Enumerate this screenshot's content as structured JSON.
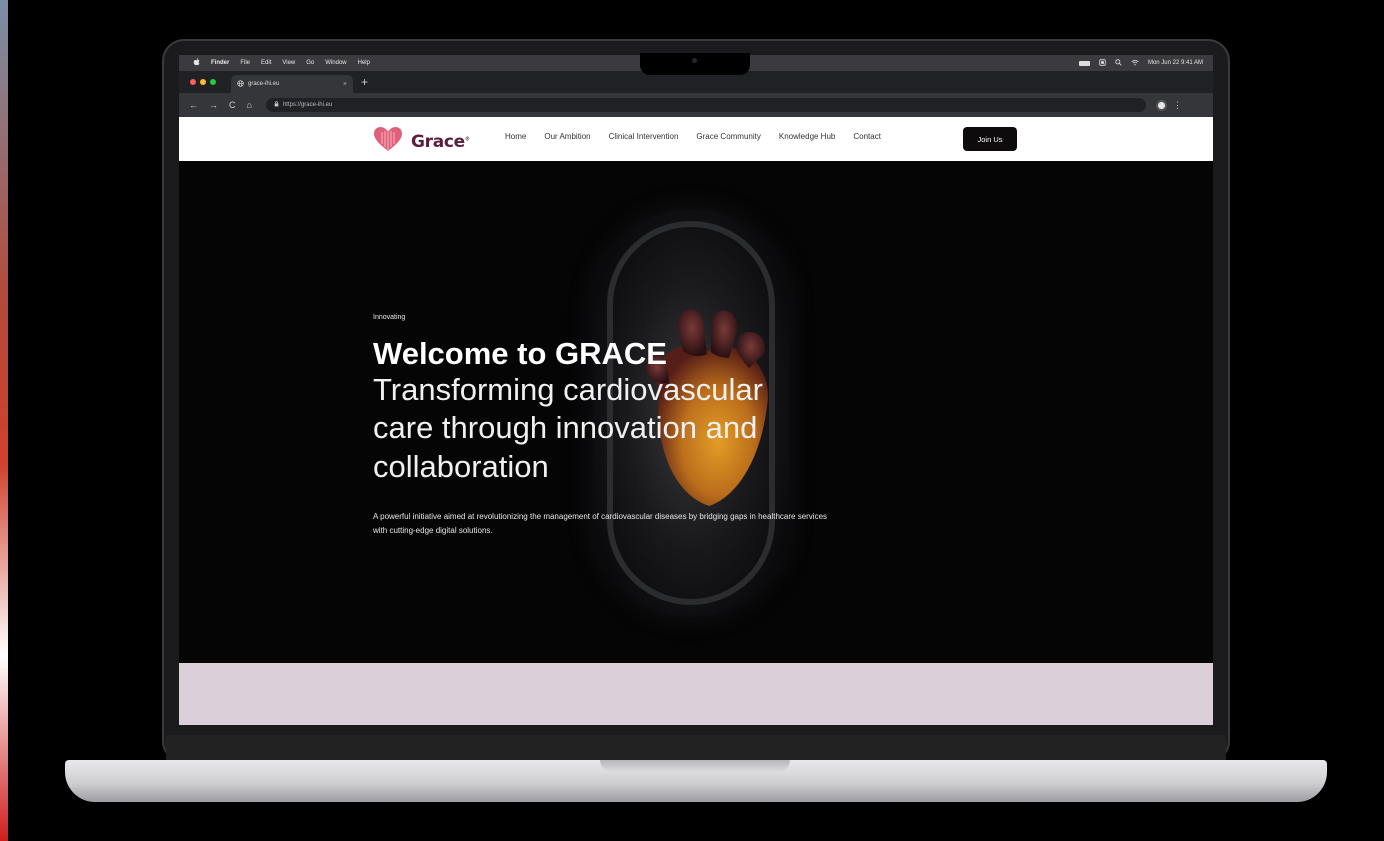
{
  "menubar": {
    "apple": "",
    "items": [
      "Finder",
      "File",
      "Edit",
      "View",
      "Go",
      "Window",
      "Help"
    ],
    "datetime": "Mon Jun 22  9:41 AM"
  },
  "browser": {
    "tab_title": "grace-ihi.eu",
    "tab_close": "×",
    "new_tab": "+",
    "url": "https://grace-ihi.eu",
    "nav": {
      "back": "←",
      "forward": "→",
      "reload": "C",
      "home": "⌂"
    },
    "menu": "⋮"
  },
  "site": {
    "logo_text": "Grace",
    "logo_mark": "®",
    "nav": [
      "Home",
      "Our Ambition",
      "Clinical Intervention",
      "Grace Community",
      "Knowledge Hub",
      "Contact"
    ],
    "cta": "Join Us"
  },
  "hero": {
    "eyebrow": "Innovating",
    "title_bold": "Welcome to GRACE",
    "title_lines": [
      "Transforming cardiovascular",
      "care through innovation and",
      "collaboration"
    ],
    "description": "A powerful initiative aimed at revolutionizing the management of cardiovascular diseases by bridging gaps in healthcare services with cutting-edge digital solutions."
  },
  "colors": {
    "brand": "#5a1f3c",
    "heart_logo": "#e0607a",
    "cta_bg": "#0d0b0c",
    "lilac_band": "#dbd0d9",
    "hero_bg": "#050506"
  }
}
